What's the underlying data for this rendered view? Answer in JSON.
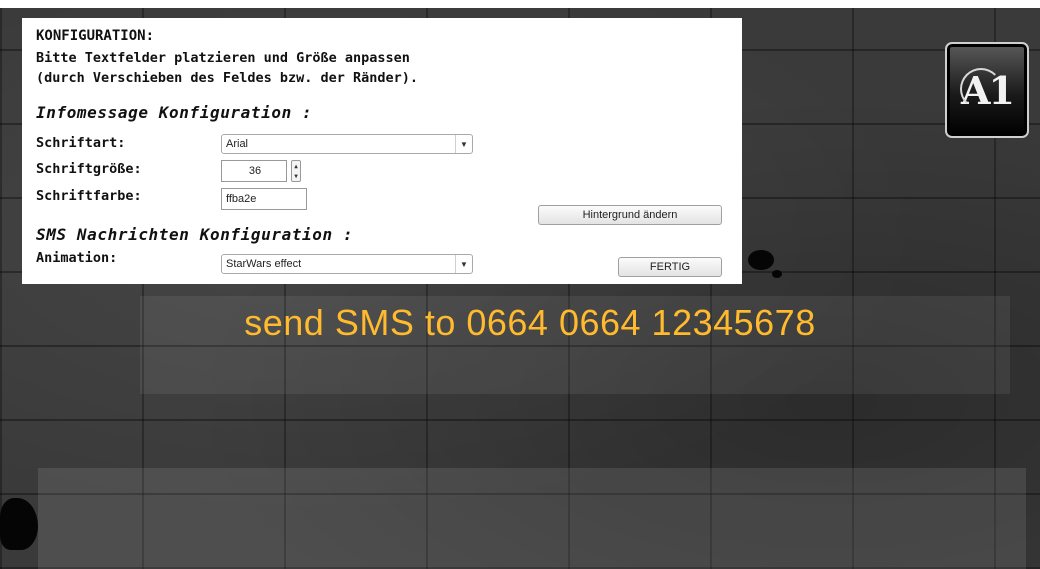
{
  "config": {
    "title": "KONFIGURATION:",
    "instruction_line1": "Bitte Textfelder platzieren und Größe anpassen",
    "instruction_line2": "(durch Verschieben des Feldes bzw. der Ränder).",
    "info_heading": "Infomessage Konfiguration :",
    "font_label": "Schriftart:",
    "font_value": "Arial",
    "size_label": "Schriftgröße:",
    "size_value": "36",
    "color_label": "Schriftfarbe:",
    "color_value": "ffba2e",
    "background_button": "Hintergrund ändern",
    "sms_heading": "SMS Nachrichten Konfiguration :",
    "animation_label": "Animation:",
    "animation_value": "StarWars effect",
    "done_button": "FERTIG"
  },
  "sms_message": "send SMS to 0664 0664 12345678",
  "logo_text": "A1",
  "colors": {
    "message": "#ffba2e",
    "panel": "#ffffff",
    "wall": "#3a3a3a"
  }
}
